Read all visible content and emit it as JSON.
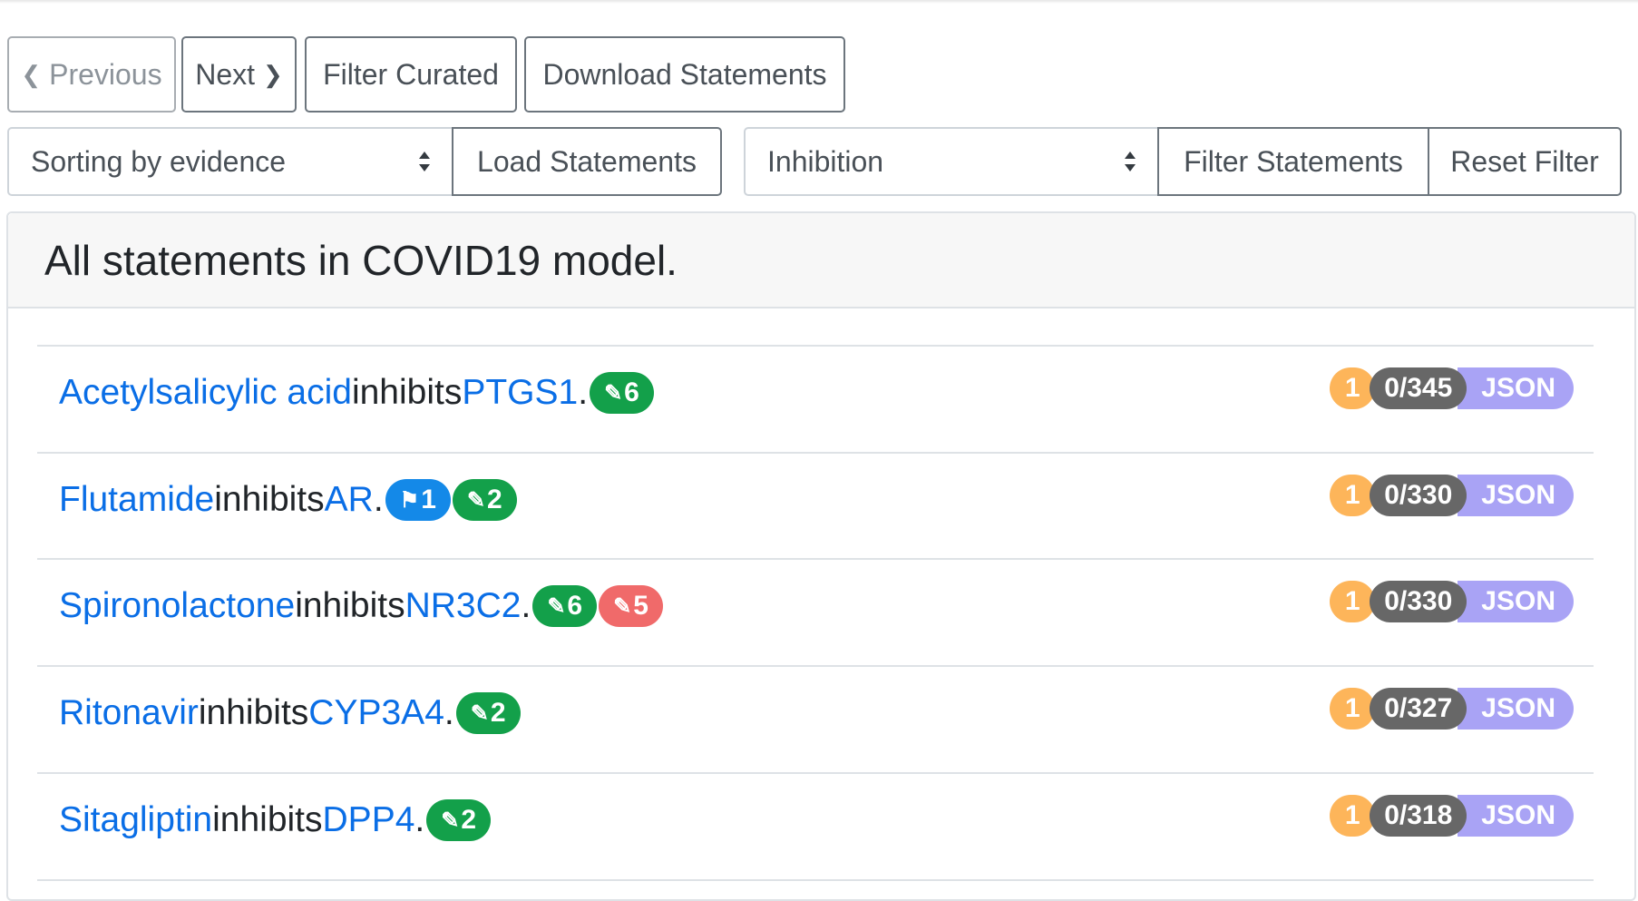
{
  "toolbar": {
    "previous_label": "Previous",
    "next_label": "Next",
    "filter_curated_label": "Filter Curated",
    "download_label": "Download Statements"
  },
  "controls": {
    "sort_select": "Sorting by evidence",
    "load_label": "Load Statements",
    "type_select": "Inhibition",
    "filter_label": "Filter Statements",
    "reset_label": "Reset Filter"
  },
  "card": {
    "title": "All statements in COVID19 model."
  },
  "statements": [
    {
      "subject": "Acetylsalicylic acid",
      "verb": "inhibits",
      "object": "PTGS1",
      "end": ".",
      "tags": [
        {
          "kind": "green",
          "icon": "✎",
          "count": "6"
        }
      ],
      "count": "1",
      "ratio": "0/345",
      "json": "JSON"
    },
    {
      "subject": "Flutamide",
      "verb": "inhibits",
      "object": "AR",
      "end": ".",
      "tags": [
        {
          "kind": "blue",
          "icon": "⚑",
          "count": "1"
        },
        {
          "kind": "green",
          "icon": "✎",
          "count": "2"
        }
      ],
      "count": "1",
      "ratio": "0/330",
      "json": "JSON"
    },
    {
      "subject": "Spironolactone",
      "verb": "inhibits",
      "object": "NR3C2",
      "end": ".",
      "tags": [
        {
          "kind": "green",
          "icon": "✎",
          "count": "6"
        },
        {
          "kind": "red",
          "icon": "✎",
          "count": "5"
        }
      ],
      "count": "1",
      "ratio": "0/330",
      "json": "JSON"
    },
    {
      "subject": "Ritonavir",
      "verb": "inhibits",
      "object": "CYP3A4",
      "end": ".",
      "tags": [
        {
          "kind": "green",
          "icon": "✎",
          "count": "2"
        }
      ],
      "count": "1",
      "ratio": "0/327",
      "json": "JSON"
    },
    {
      "subject": "Sitagliptin",
      "verb": "inhibits",
      "object": "DPP4",
      "end": ".",
      "tags": [
        {
          "kind": "green",
          "icon": "✎",
          "count": "2"
        }
      ],
      "count": "1",
      "ratio": "0/318",
      "json": "JSON"
    }
  ],
  "colors": {
    "entity": "#0a6ee6",
    "curated_correct": "#13a04a",
    "curated_incorrect": "#f06a6a",
    "flag": "#1489e8",
    "evidence_count": "#fdb55a",
    "ratio": "#676767",
    "json": "#a9a3f5"
  },
  "icons": {
    "previous": "chevron-left-icon",
    "next": "chevron-right-icon",
    "select": "sort-arrows-icon",
    "tag_curation": "pencil-icon",
    "tag_flag": "flag-icon"
  }
}
